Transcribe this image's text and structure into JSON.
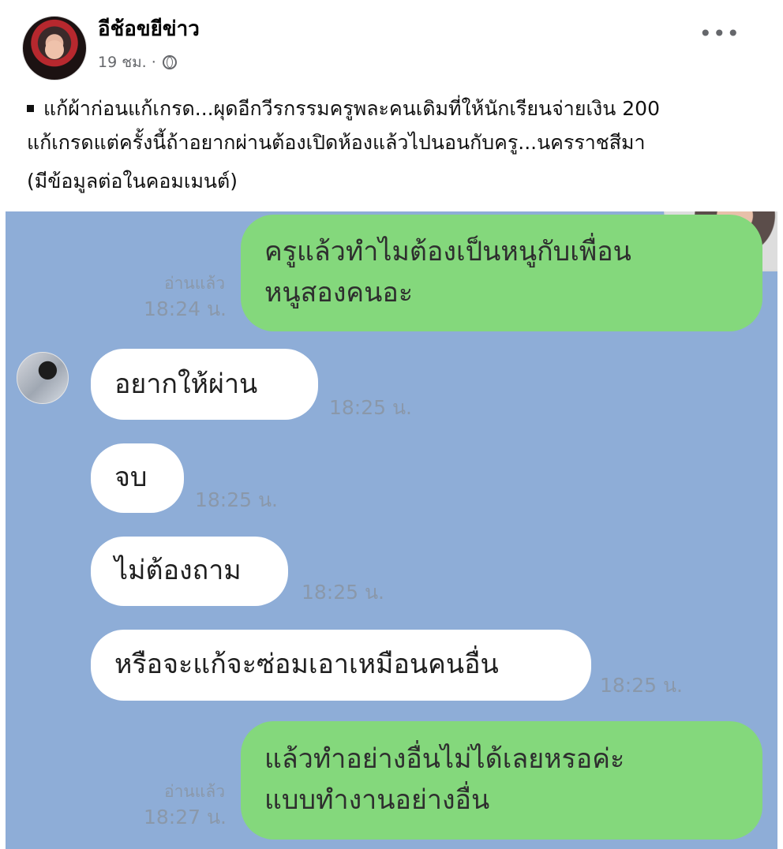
{
  "post": {
    "page_name": "อีช้อขยีข่าว",
    "meta_time": "19 ชม. ·",
    "caption_line_1": "แก้ผ้าก่อนแก้เกรด...ผุดอีกวีรกรรมครูพละคนเดิมที่ให้นักเรียนจ่ายเงิน 200",
    "caption_line_2": "แก้เกรดแต่ครั้งนี้ถ้าอยากผ่านต้องเปิดห้องแล้วไปนอนกับครู...นครราชสีมา",
    "caption_more": "(มีข้อมูลต่อในคอมเมนต์)",
    "more_label": "•••"
  },
  "chat": {
    "messages": [
      {
        "side": "sent",
        "lines": [
          "ครูแล้วทำไมต้องเป็นหนูกับเพื่อน",
          "หนูสองคนอะ"
        ],
        "read": "อ่านแล้ว",
        "time": "18:24 น."
      },
      {
        "side": "received",
        "text": "อยากให้ผ่าน",
        "time": "18:25 น."
      },
      {
        "side": "received",
        "text": "จบ",
        "time": "18:25 น."
      },
      {
        "side": "received",
        "text": "ไม่ต้องถาม",
        "time": "18:25 น."
      },
      {
        "side": "received",
        "text": "หรือจะแก้จะซ่อมเอาเหมือนคนอื่น",
        "time": "18:25 น."
      },
      {
        "side": "sent",
        "lines": [
          "แล้วทำอย่างอื่นไม่ได้เลยหรอค่ะ",
          "แบบทำงานอย่างอื่น"
        ],
        "read": "อ่านแล้ว",
        "time": "18:27 น."
      }
    ]
  },
  "icons": {
    "privacy": "globe-icon",
    "menu": "more-horizontal-icon"
  }
}
